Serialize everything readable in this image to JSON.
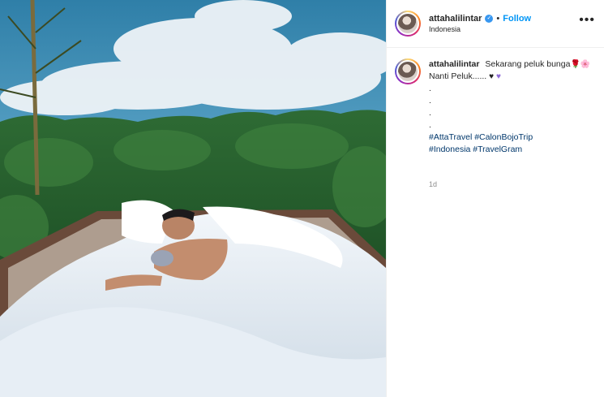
{
  "post": {
    "username": "attahalilintar",
    "verified_mark": "✓",
    "separator": "•",
    "follow_label": "Follow",
    "location": "Indonesia",
    "more_label": "•••"
  },
  "caption": {
    "username": "attahalilintar",
    "line1": "Sekarang peluk bunga",
    "emoji_rose": "🌹",
    "emoji_flower": "🌸",
    "line2": "Nanti Peluk......",
    "heart_black": "♥",
    "heart_purple": "♥",
    "dots": [
      ".",
      ".",
      ".",
      "."
    ],
    "hashtags_line1": "#AttaTravel #CalonBojoTrip",
    "hashtags_line2": "#Indonesia #TravelGram",
    "timestamp": "1d"
  },
  "colors": {
    "link_blue": "#0095f6",
    "hashtag_blue": "#00376b",
    "verified_blue": "#3897f0",
    "muted_gray": "#8e8e8e"
  },
  "icons": {
    "more": "more-options-icon",
    "verified": "verified-badge-icon"
  }
}
